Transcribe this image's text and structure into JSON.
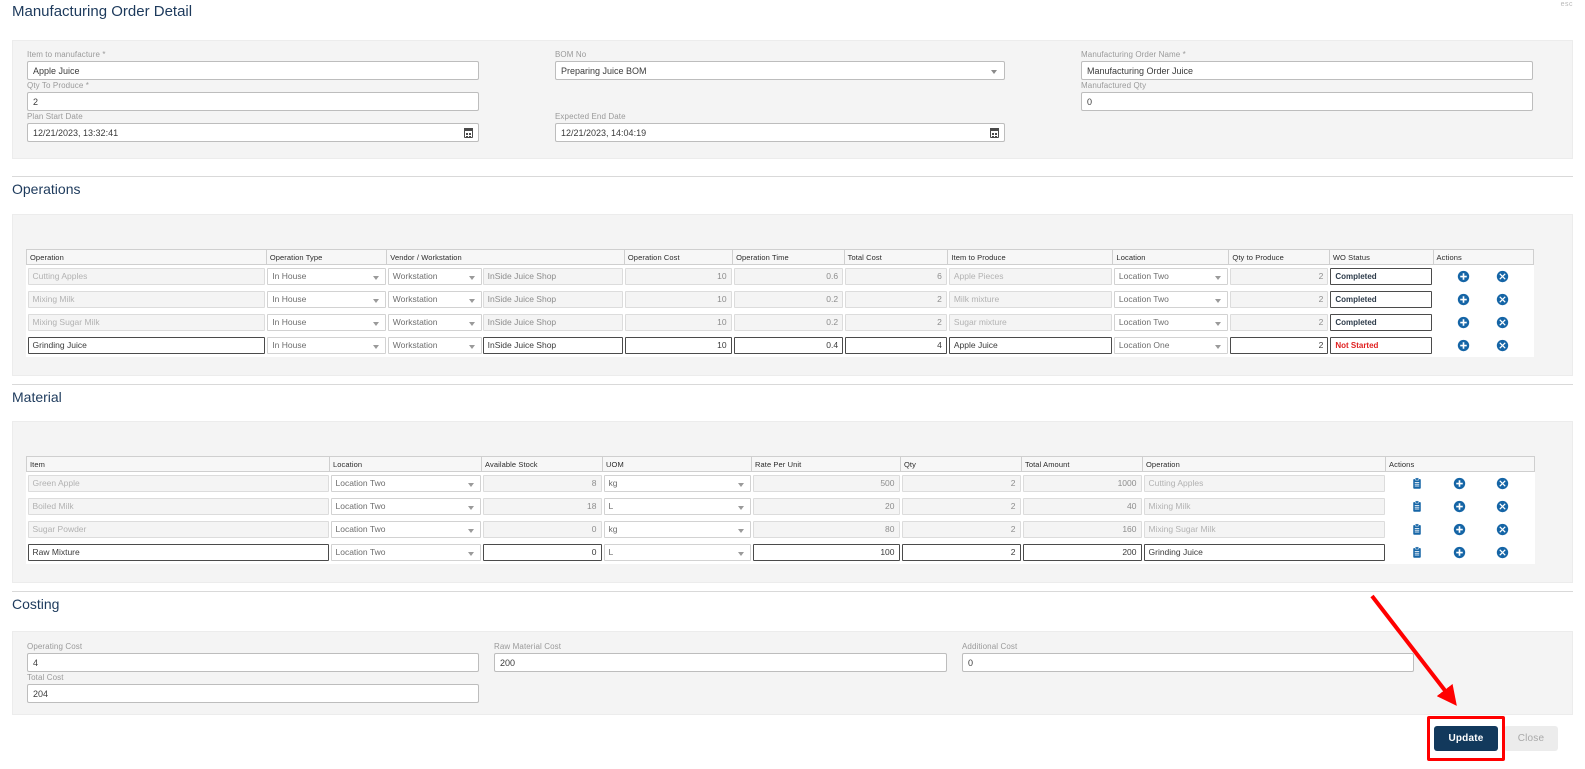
{
  "header": {
    "title": "Manufacturing Order Detail",
    "esc_hint": "esc"
  },
  "order_form": {
    "item_to_manufacture": {
      "label": "Item to manufacture *",
      "value": "Apple Juice"
    },
    "qty_to_produce": {
      "label": "Qty To Produce *",
      "value": "2"
    },
    "plan_start_date": {
      "label": "Plan Start Date",
      "value": "12/21/2023, 13:32:41",
      "icon": "calendar-icon"
    },
    "bom_no": {
      "label": "BOM No",
      "value": "Preparing Juice BOM",
      "icon": "chevron-down-icon"
    },
    "expected_end_date": {
      "label": "Expected End Date",
      "value": "12/21/2023, 14:04:19",
      "icon": "calendar-icon"
    },
    "mo_name": {
      "label": "Manufacturing Order Name *",
      "value": "Manufacturing Order Juice"
    },
    "manufactured_qty": {
      "label": "Manufactured Qty",
      "value": "0"
    }
  },
  "operations": {
    "section_title": "Operations",
    "columns": [
      "Operation",
      "Operation Type",
      "Vendor / Workstation",
      "Operation Cost",
      "Operation Time",
      "Total Cost",
      "Item to Produce",
      "Location",
      "Qty to Produce",
      "WO Status",
      "Actions"
    ],
    "rows": [
      {
        "operation": "Cutting Apples",
        "operation_type": "In House",
        "vendor_type": "Workstation",
        "vendor": "InSide Juice Shop",
        "operation_cost": "10",
        "operation_time": "0.6",
        "total_cost": "6",
        "item_to_produce": "Apple Pieces",
        "location": "Location Two",
        "qty_to_produce": "2",
        "wo_status": "Completed",
        "status_state": "ok",
        "editable": false
      },
      {
        "operation": "Mixing Milk",
        "operation_type": "In House",
        "vendor_type": "Workstation",
        "vendor": "InSide Juice Shop",
        "operation_cost": "10",
        "operation_time": "0.2",
        "total_cost": "2",
        "item_to_produce": "Milk mixture",
        "location": "Location Two",
        "qty_to_produce": "2",
        "wo_status": "Completed",
        "status_state": "ok",
        "editable": false
      },
      {
        "operation": "Mixing Sugar Milk",
        "operation_type": "In House",
        "vendor_type": "Workstation",
        "vendor": "InSide Juice Shop",
        "operation_cost": "10",
        "operation_time": "0.2",
        "total_cost": "2",
        "item_to_produce": "Sugar mixture",
        "location": "Location Two",
        "qty_to_produce": "2",
        "wo_status": "Completed",
        "status_state": "ok",
        "editable": false
      },
      {
        "operation": "Grinding Juice",
        "operation_type": "In House",
        "vendor_type": "Workstation",
        "vendor": "InSide Juice Shop",
        "operation_cost": "10",
        "operation_time": "0.4",
        "total_cost": "4",
        "item_to_produce": "Apple Juice",
        "location": "Location One",
        "qty_to_produce": "2",
        "wo_status": "Not Started",
        "status_state": "no",
        "editable": true
      }
    ],
    "action_icons": [
      "add-circle-icon",
      "remove-circle-icon"
    ]
  },
  "material": {
    "section_title": "Material",
    "columns": [
      "Item",
      "Location",
      "Available Stock",
      "UOM",
      "Rate Per Unit",
      "Qty",
      "Total Amount",
      "Operation",
      "Actions"
    ],
    "rows": [
      {
        "item": "Green Apple",
        "location": "Location Two",
        "available_stock": "8",
        "uom": "kg",
        "rate_per_unit": "500",
        "qty": "2",
        "total_amount": "1000",
        "operation": "Cutting Apples",
        "editable": false
      },
      {
        "item": "Boiled Milk",
        "location": "Location Two",
        "available_stock": "18",
        "uom": "L",
        "rate_per_unit": "20",
        "qty": "2",
        "total_amount": "40",
        "operation": "Mixing Milk",
        "editable": false
      },
      {
        "item": "Sugar Powder",
        "location": "Location Two",
        "available_stock": "0",
        "uom": "kg",
        "rate_per_unit": "80",
        "qty": "2",
        "total_amount": "160",
        "operation": "Mixing Sugar Milk",
        "editable": false
      },
      {
        "item": "Raw Mixture",
        "location": "Location Two",
        "available_stock": "0",
        "uom": "L",
        "rate_per_unit": "100",
        "qty": "2",
        "total_amount": "200",
        "operation": "Grinding Juice",
        "editable": true
      }
    ],
    "action_icons": [
      "clipboard-icon",
      "add-circle-icon",
      "remove-circle-icon"
    ]
  },
  "costing": {
    "section_title": "Costing",
    "operating_cost": {
      "label": "Operating Cost",
      "value": "4"
    },
    "raw_material_cost": {
      "label": "Raw Material Cost",
      "value": "200"
    },
    "additional_cost": {
      "label": "Additional Cost",
      "value": "0"
    },
    "total_cost": {
      "label": "Total Cost",
      "value": "204"
    }
  },
  "footer": {
    "update_label": "Update",
    "close_label": "Close"
  },
  "annotation": {
    "color": "#ff0000",
    "target": "update-button"
  },
  "colors": {
    "accent": "#1d3a5c",
    "primary_button": "#12395c",
    "icon_blue": "#1565a6",
    "status_error": "#e02020",
    "panel_bg": "#f4f4f4",
    "annotation_red": "#ff0000"
  }
}
